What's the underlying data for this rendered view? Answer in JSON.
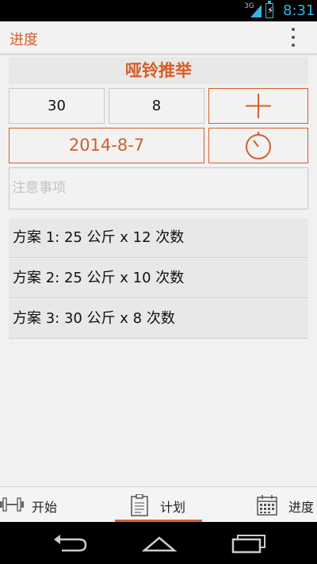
{
  "status_bar": {
    "network": "3G",
    "time": "8:31"
  },
  "action_bar": {
    "title": "进度",
    "overflow_icon": "overflow-menu-icon"
  },
  "exercise": {
    "name": "哑铃推举"
  },
  "inputs": {
    "weight": "30",
    "reps": "8",
    "date": "2014-8-7",
    "notes_placeholder": "注意事项"
  },
  "plans": [
    {
      "label": "方案 1: 25 公斤 x 12 次数"
    },
    {
      "label": "方案 2: 25 公斤 x 10 次数"
    },
    {
      "label": "方案 3: 30 公斤 x 8 次数"
    }
  ],
  "tabs": [
    {
      "label": "开始",
      "icon": "dumbbell-icon"
    },
    {
      "label": "计划",
      "icon": "clipboard-icon",
      "selected": true
    },
    {
      "label": "进度",
      "icon": "calendar-icon"
    }
  ],
  "colors": {
    "accent": "#d65e2a",
    "status_blue": "#33b5e5"
  }
}
